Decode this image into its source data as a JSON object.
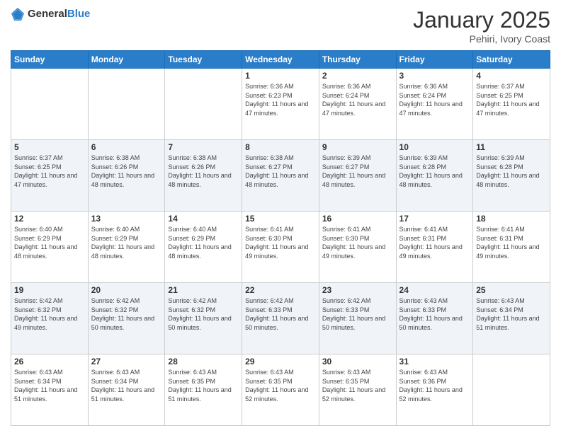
{
  "header": {
    "logo_general": "General",
    "logo_blue": "Blue",
    "month_title": "January 2025",
    "subtitle": "Pehiri, Ivory Coast"
  },
  "weekdays": [
    "Sunday",
    "Monday",
    "Tuesday",
    "Wednesday",
    "Thursday",
    "Friday",
    "Saturday"
  ],
  "weeks": [
    [
      {
        "day": "",
        "info": ""
      },
      {
        "day": "",
        "info": ""
      },
      {
        "day": "",
        "info": ""
      },
      {
        "day": "1",
        "sunrise": "Sunrise: 6:36 AM",
        "sunset": "Sunset: 6:23 PM",
        "daylight": "Daylight: 11 hours and 47 minutes."
      },
      {
        "day": "2",
        "sunrise": "Sunrise: 6:36 AM",
        "sunset": "Sunset: 6:24 PM",
        "daylight": "Daylight: 11 hours and 47 minutes."
      },
      {
        "day": "3",
        "sunrise": "Sunrise: 6:36 AM",
        "sunset": "Sunset: 6:24 PM",
        "daylight": "Daylight: 11 hours and 47 minutes."
      },
      {
        "day": "4",
        "sunrise": "Sunrise: 6:37 AM",
        "sunset": "Sunset: 6:25 PM",
        "daylight": "Daylight: 11 hours and 47 minutes."
      }
    ],
    [
      {
        "day": "5",
        "sunrise": "Sunrise: 6:37 AM",
        "sunset": "Sunset: 6:25 PM",
        "daylight": "Daylight: 11 hours and 47 minutes."
      },
      {
        "day": "6",
        "sunrise": "Sunrise: 6:38 AM",
        "sunset": "Sunset: 6:26 PM",
        "daylight": "Daylight: 11 hours and 48 minutes."
      },
      {
        "day": "7",
        "sunrise": "Sunrise: 6:38 AM",
        "sunset": "Sunset: 6:26 PM",
        "daylight": "Daylight: 11 hours and 48 minutes."
      },
      {
        "day": "8",
        "sunrise": "Sunrise: 6:38 AM",
        "sunset": "Sunset: 6:27 PM",
        "daylight": "Daylight: 11 hours and 48 minutes."
      },
      {
        "day": "9",
        "sunrise": "Sunrise: 6:39 AM",
        "sunset": "Sunset: 6:27 PM",
        "daylight": "Daylight: 11 hours and 48 minutes."
      },
      {
        "day": "10",
        "sunrise": "Sunrise: 6:39 AM",
        "sunset": "Sunset: 6:28 PM",
        "daylight": "Daylight: 11 hours and 48 minutes."
      },
      {
        "day": "11",
        "sunrise": "Sunrise: 6:39 AM",
        "sunset": "Sunset: 6:28 PM",
        "daylight": "Daylight: 11 hours and 48 minutes."
      }
    ],
    [
      {
        "day": "12",
        "sunrise": "Sunrise: 6:40 AM",
        "sunset": "Sunset: 6:29 PM",
        "daylight": "Daylight: 11 hours and 48 minutes."
      },
      {
        "day": "13",
        "sunrise": "Sunrise: 6:40 AM",
        "sunset": "Sunset: 6:29 PM",
        "daylight": "Daylight: 11 hours and 48 minutes."
      },
      {
        "day": "14",
        "sunrise": "Sunrise: 6:40 AM",
        "sunset": "Sunset: 6:29 PM",
        "daylight": "Daylight: 11 hours and 48 minutes."
      },
      {
        "day": "15",
        "sunrise": "Sunrise: 6:41 AM",
        "sunset": "Sunset: 6:30 PM",
        "daylight": "Daylight: 11 hours and 49 minutes."
      },
      {
        "day": "16",
        "sunrise": "Sunrise: 6:41 AM",
        "sunset": "Sunset: 6:30 PM",
        "daylight": "Daylight: 11 hours and 49 minutes."
      },
      {
        "day": "17",
        "sunrise": "Sunrise: 6:41 AM",
        "sunset": "Sunset: 6:31 PM",
        "daylight": "Daylight: 11 hours and 49 minutes."
      },
      {
        "day": "18",
        "sunrise": "Sunrise: 6:41 AM",
        "sunset": "Sunset: 6:31 PM",
        "daylight": "Daylight: 11 hours and 49 minutes."
      }
    ],
    [
      {
        "day": "19",
        "sunrise": "Sunrise: 6:42 AM",
        "sunset": "Sunset: 6:32 PM",
        "daylight": "Daylight: 11 hours and 49 minutes."
      },
      {
        "day": "20",
        "sunrise": "Sunrise: 6:42 AM",
        "sunset": "Sunset: 6:32 PM",
        "daylight": "Daylight: 11 hours and 50 minutes."
      },
      {
        "day": "21",
        "sunrise": "Sunrise: 6:42 AM",
        "sunset": "Sunset: 6:32 PM",
        "daylight": "Daylight: 11 hours and 50 minutes."
      },
      {
        "day": "22",
        "sunrise": "Sunrise: 6:42 AM",
        "sunset": "Sunset: 6:33 PM",
        "daylight": "Daylight: 11 hours and 50 minutes."
      },
      {
        "day": "23",
        "sunrise": "Sunrise: 6:42 AM",
        "sunset": "Sunset: 6:33 PM",
        "daylight": "Daylight: 11 hours and 50 minutes."
      },
      {
        "day": "24",
        "sunrise": "Sunrise: 6:43 AM",
        "sunset": "Sunset: 6:33 PM",
        "daylight": "Daylight: 11 hours and 50 minutes."
      },
      {
        "day": "25",
        "sunrise": "Sunrise: 6:43 AM",
        "sunset": "Sunset: 6:34 PM",
        "daylight": "Daylight: 11 hours and 51 minutes."
      }
    ],
    [
      {
        "day": "26",
        "sunrise": "Sunrise: 6:43 AM",
        "sunset": "Sunset: 6:34 PM",
        "daylight": "Daylight: 11 hours and 51 minutes."
      },
      {
        "day": "27",
        "sunrise": "Sunrise: 6:43 AM",
        "sunset": "Sunset: 6:34 PM",
        "daylight": "Daylight: 11 hours and 51 minutes."
      },
      {
        "day": "28",
        "sunrise": "Sunrise: 6:43 AM",
        "sunset": "Sunset: 6:35 PM",
        "daylight": "Daylight: 11 hours and 51 minutes."
      },
      {
        "day": "29",
        "sunrise": "Sunrise: 6:43 AM",
        "sunset": "Sunset: 6:35 PM",
        "daylight": "Daylight: 11 hours and 52 minutes."
      },
      {
        "day": "30",
        "sunrise": "Sunrise: 6:43 AM",
        "sunset": "Sunset: 6:35 PM",
        "daylight": "Daylight: 11 hours and 52 minutes."
      },
      {
        "day": "31",
        "sunrise": "Sunrise: 6:43 AM",
        "sunset": "Sunset: 6:36 PM",
        "daylight": "Daylight: 11 hours and 52 minutes."
      },
      {
        "day": "",
        "info": ""
      }
    ]
  ]
}
